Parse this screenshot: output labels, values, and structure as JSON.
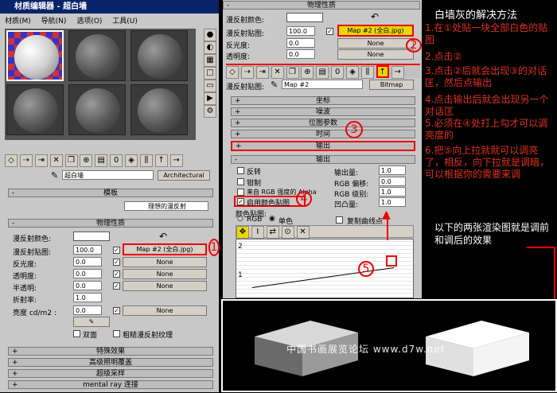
{
  "left_panel": {
    "title": "材质编辑器 - 超白墙",
    "menu": [
      "材质(M)",
      "导航(N)",
      "选项(O)",
      "工具(U)"
    ],
    "material_name": "超白墙",
    "material_type": "Architectural",
    "template_section": "模板",
    "template_value": "理想的漫反射",
    "physical_section": "物理性质",
    "rows": [
      {
        "label": "漫反射颜色:",
        "value": "",
        "button": ""
      },
      {
        "label": "漫反射贴图:",
        "value": "100.0",
        "button": "Map #2 (全白.jpg)"
      },
      {
        "label": "反光度:",
        "value": "0.0",
        "button": "None"
      },
      {
        "label": "透明度:",
        "value": "0.0",
        "button": "None"
      },
      {
        "label": "半透明:",
        "value": "0.0",
        "button": "None"
      },
      {
        "label": "折射率:",
        "value": "1.0",
        "button": ""
      },
      {
        "label": "亮度 cd/m2 :",
        "value": "0.0",
        "button": "None"
      }
    ],
    "checkbox_double": "双面",
    "checkbox_rough": "粗糙漫反射纹理",
    "bottom_rollouts": [
      "特殊效果",
      "高级照明覆盖",
      "超级采样",
      "mental ray 连接"
    ]
  },
  "right_panel": {
    "top_section": "物理性质",
    "rows": [
      {
        "label": "漫反射颜色:",
        "value": "",
        "button": ""
      },
      {
        "label": "漫反射贴图:",
        "value": "100.0",
        "button": "Map #2 (全白.jpg)"
      },
      {
        "label": "反光度:",
        "value": "0.0",
        "button": "None"
      },
      {
        "label": "透明度:",
        "value": "0.0",
        "button": "None"
      }
    ],
    "map_label": "漫反射贴图:",
    "map_name": "Map #2",
    "map_type": "Bitmap",
    "rollouts": [
      "坐标",
      "噪波",
      "位图参数",
      "时间",
      "输出"
    ],
    "output_section": "输出",
    "out_left": [
      "反转",
      "钳制",
      "来自 RGB 强度的 Alpha",
      "启用颜色贴图"
    ],
    "out_right": [
      {
        "label": "输出量:",
        "value": "1.0"
      },
      {
        "label": "RGB 偏移:",
        "value": "0.0"
      },
      {
        "label": "RGB 级别:",
        "value": "1.0"
      },
      {
        "label": "凹凸量:",
        "value": "1.0"
      }
    ],
    "colormap_label": "颜色贴图:",
    "radio_rgb": "RGB",
    "radio_mono": "单色",
    "copy_curve": "复制曲线点",
    "graph_ticks": [
      "2",
      "1"
    ]
  },
  "notes": {
    "heading": "白墙灰的解决方法",
    "steps": [
      "1.在①处贴一块全部白色的贴图",
      "2.点击②",
      "3.点击②后就会出现③的对话匡，然后点输出",
      "4.点击输出后就会出现另一个对话匡",
      "5.必须在④处打上勾才可以调亮度的",
      "6.把⑤向上拉就就可以调亮了，相反，向下拉就是调暗，可以根据你的需要来调"
    ],
    "render_note": "以下的两张渲染图就是调前和调后的效果"
  },
  "watermark": "中国书画展览论坛 www.d7w.net",
  "callout_numbers": [
    "1",
    "2",
    "3",
    "4",
    "5"
  ]
}
